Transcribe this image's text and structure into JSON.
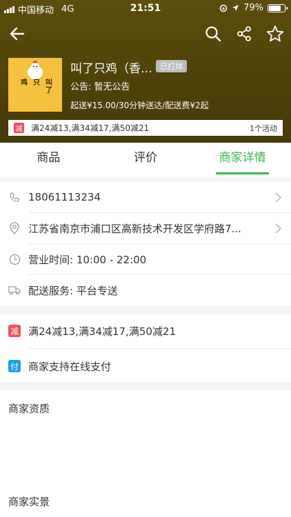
{
  "status_bar": {
    "carrier": "中国移动",
    "network": "4G",
    "time": "21:51",
    "battery": "79%",
    "battery_level": 0.79
  },
  "nav": {
    "back_icon": "back-arrow-icon",
    "search_icon": "search-icon",
    "share_icon": "share-icon",
    "favorite_icon": "star-icon"
  },
  "shop": {
    "logo_text": [
      "鸡",
      "只",
      "叫了"
    ],
    "name": "叫了只鸡（香…",
    "status_badge": "已打烊",
    "notice": "公告: 暂无公告",
    "delivery_info": "起送¥15.00/30分钟送达/配送费¥2起",
    "promo_tag": "减",
    "promo_text": "满24减13,满34减17,满50减21",
    "activity_count": "1个活动"
  },
  "tabs": [
    {
      "label": "商品",
      "active": false
    },
    {
      "label": "评价",
      "active": false
    },
    {
      "label": "商家详情",
      "active": true
    }
  ],
  "details": {
    "phone": "18061113234",
    "address": "江苏省南京市浦口区高新技术开发区学府路7...",
    "hours": "营业时间: 10:00 - 22:00",
    "delivery_service": "配送服务: 平台专送"
  },
  "promotions": {
    "discount_tag": "减",
    "discount_text": "满24减13,满34减17,满50减21",
    "pay_tag": "付",
    "pay_text": "商家支持在线支付"
  },
  "sections": {
    "qualification": "商家资质",
    "photos": "商家实景"
  },
  "colors": {
    "accent_green": "#3cb64a",
    "header_bg": "#4f4209",
    "discount_red": "#f04f59",
    "pay_blue": "#1aa0e8",
    "logo_yellow": "#f5c23f"
  }
}
